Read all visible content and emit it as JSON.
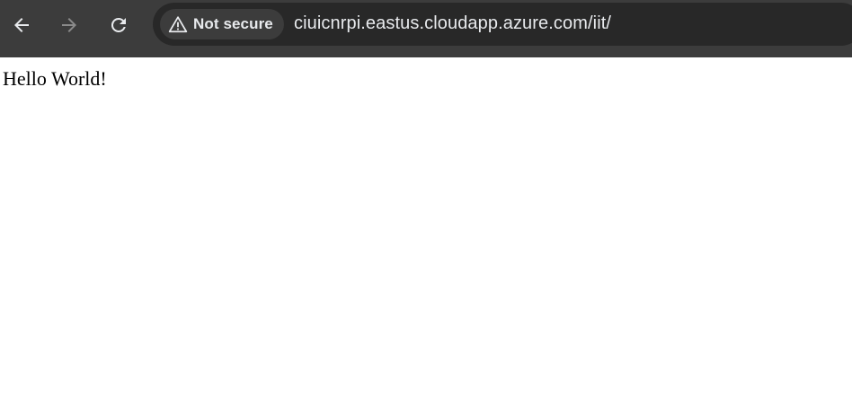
{
  "browser": {
    "toolbar_color": "#3c3c3c",
    "nav": {
      "back_icon": "arrow-left-icon",
      "forward_icon": "arrow-right-icon",
      "forward_enabled": false,
      "reload_icon": "reload-icon"
    },
    "omnibox": {
      "security_icon": "warning-triangle-icon",
      "security_label": "Not secure",
      "url": "ciuicnrpi.eastus.cloudapp.azure.com/iit/"
    }
  },
  "page": {
    "text": "Hello World!"
  }
}
